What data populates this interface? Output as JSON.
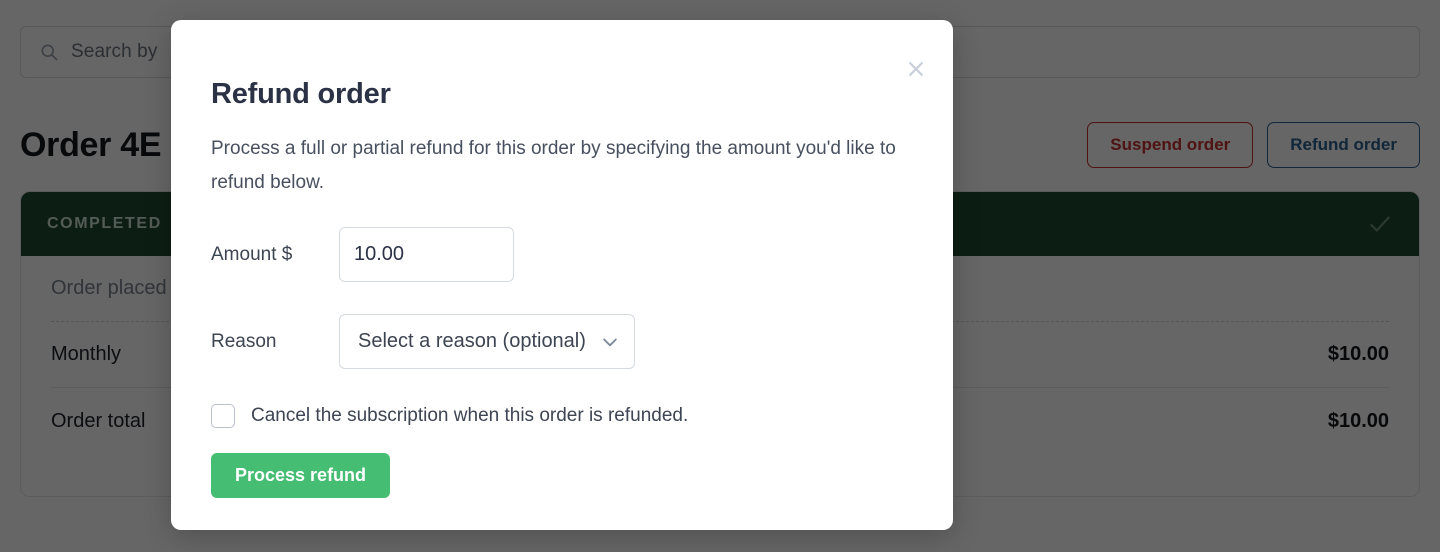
{
  "background": {
    "search": {
      "icon": "search-icon",
      "placeholder_visible": "Search by"
    },
    "page_title": "Order 4E",
    "actions": {
      "suspend_label": "Suspend order",
      "suspend_color": "#c2302e",
      "refund_label": "Refund order",
      "refund_color": "#2b5f8f"
    },
    "order_card": {
      "status": {
        "label": "COMPLETED",
        "banner_color": "#1f4a33",
        "icon": "check-icon"
      },
      "rows": [
        {
          "label": "Order placed",
          "value": "",
          "muted": true
        },
        {
          "label": "Monthly",
          "value": "$10.00",
          "muted": false
        },
        {
          "label": "Order total",
          "value": "$10.00",
          "muted": false
        }
      ]
    }
  },
  "modal": {
    "title": "Refund order",
    "close_icon": "close-icon",
    "description": "Process a full or partial refund for this order by specifying the amount you'd like to refund below.",
    "amount": {
      "label": "Amount $",
      "value": "10.00",
      "placeholder": "0.00"
    },
    "reason": {
      "label": "Reason",
      "selected": "Select a reason (optional)",
      "chevron_icon": "chevron-down-icon"
    },
    "cancel_subscription": {
      "label": "Cancel the subscription when this order is refunded.",
      "checked": false
    },
    "submit": {
      "label": "Process refund",
      "color": "#45bd72"
    }
  }
}
